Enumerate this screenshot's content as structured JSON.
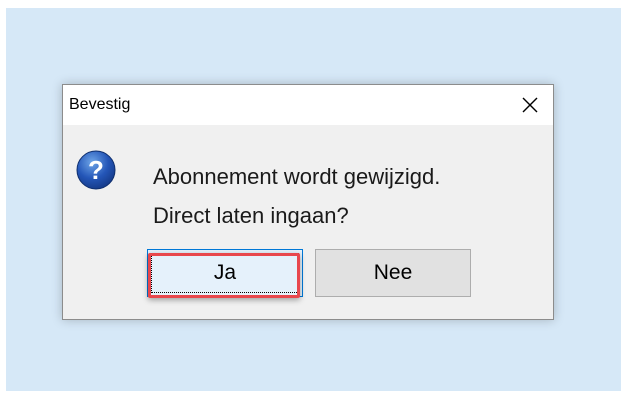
{
  "dialog": {
    "title": "Bevestig",
    "close_icon": "close-icon",
    "message_icon": "question-icon",
    "message_line1": "Abonnement wordt gewijzigd.",
    "message_line2": "Direct laten ingaan?",
    "buttons": {
      "yes_label": "Ja",
      "no_label": "Nee"
    }
  },
  "colors": {
    "backdrop": "#d6e8f7",
    "dialog_bg": "#f0f0f0",
    "highlight": "#e8474d",
    "default_button_border": "#0078d7"
  }
}
